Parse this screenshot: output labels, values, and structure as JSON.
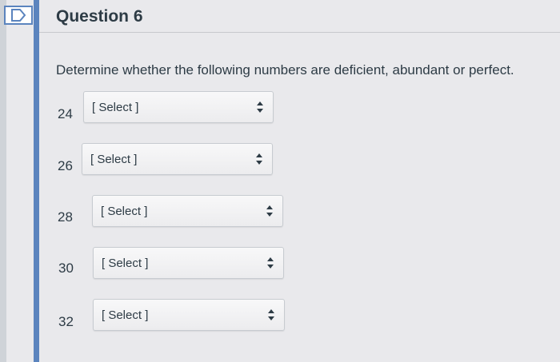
{
  "question": {
    "title": "Question 6",
    "instructions": "Determine whether the following numbers are deficient, abundant or perfect."
  },
  "items": [
    {
      "number": "24",
      "selected": "[ Select ]"
    },
    {
      "number": "26",
      "selected": "[ Select ]"
    },
    {
      "number": "28",
      "selected": "[ Select ]"
    },
    {
      "number": "30",
      "selected": "[ Select ]"
    },
    {
      "number": "32",
      "selected": "[ Select ]"
    }
  ],
  "icons": {
    "flag": "bookmark-flag-icon",
    "dropdown": "up-down-arrows-icon"
  },
  "colors": {
    "accent_bar": "#5b84be",
    "text": "#2d3b45",
    "background": "#e9e9ec"
  }
}
